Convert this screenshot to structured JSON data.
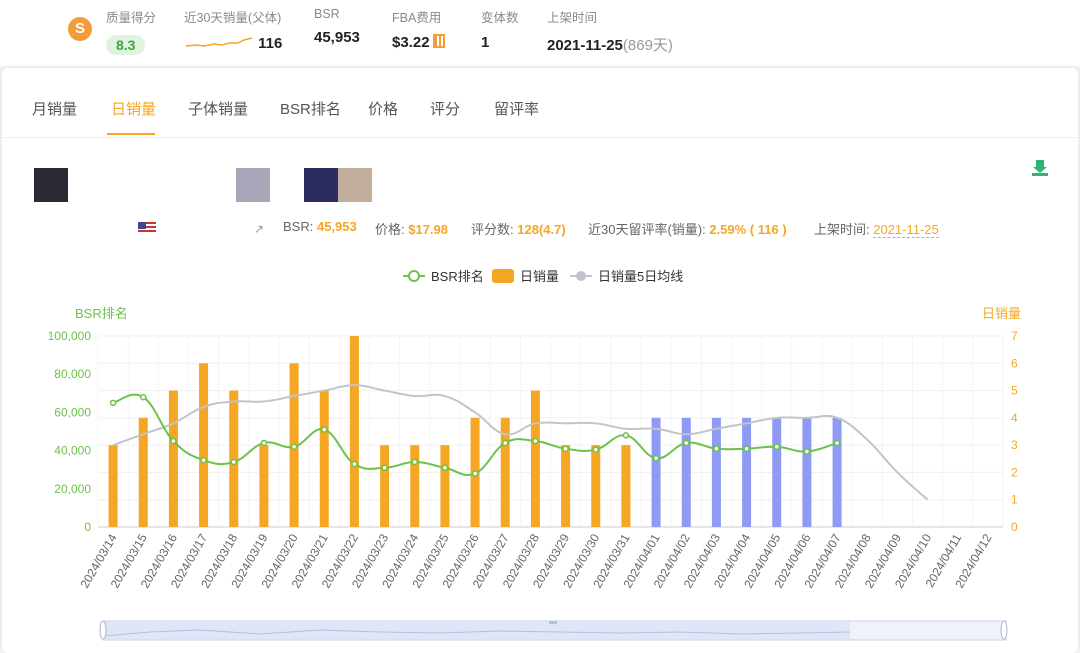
{
  "header": {
    "metrics": [
      {
        "label": "质量得分",
        "value": "8.3"
      },
      {
        "label": "近30天销量(父体)",
        "value": "116"
      },
      {
        "label": "BSR",
        "value": "45,953"
      },
      {
        "label": "FBA费用",
        "value": "$3.22"
      },
      {
        "label": "变体数",
        "value": "1"
      },
      {
        "label": "上架时间",
        "value": "2021-11-25",
        "extra": "(869天)"
      }
    ]
  },
  "tabs": [
    "月销量",
    "日销量",
    "子体销量",
    "BSR排名",
    "价格",
    "评分",
    "留评率"
  ],
  "active_tab": "日销量",
  "swatch_colors": [
    "#2a2a35",
    "#a8a6b8",
    "#2a2d5e",
    "#c2ae9c"
  ],
  "info": {
    "bsr_label": "BSR: ",
    "bsr_value": "45,953",
    "price_label": "价格: ",
    "price_value": "$17.98",
    "reviews_label": "评分数: ",
    "reviews_value": "128(4.7)",
    "rate_label": "近30天留评率(销量): ",
    "rate_value": "2.59% ( 116 )",
    "listed_label": "上架时间: ",
    "listed_value": "2021-11-25"
  },
  "colors": {
    "accent": "#f5a623",
    "bsr_line": "#6cc24a",
    "avg_line": "#c0c4cc",
    "forecast_bar": "#8f9af5"
  },
  "chart_data": {
    "type": "bar",
    "legend_position": "top-center",
    "y_left_label": "BSR排名",
    "y_right_label": "日销量",
    "y_left_ticks": [
      "0",
      "20,000",
      "40,000",
      "60,000",
      "80,000",
      "100,000"
    ],
    "y_right_ticks": [
      "0",
      "1",
      "2",
      "3",
      "4",
      "5",
      "6",
      "7"
    ],
    "ylim_left": [
      0,
      100000
    ],
    "ylim_right": [
      0,
      7
    ],
    "categories": [
      "2024/03/14",
      "2024/03/15",
      "2024/03/16",
      "2024/03/17",
      "2024/03/18",
      "2024/03/19",
      "2024/03/20",
      "2024/03/21",
      "2024/03/22",
      "2024/03/23",
      "2024/03/24",
      "2024/03/25",
      "2024/03/26",
      "2024/03/27",
      "2024/03/28",
      "2024/03/29",
      "2024/03/30",
      "2024/03/31",
      "2024/04/01",
      "2024/04/02",
      "2024/04/03",
      "2024/04/04",
      "2024/04/05",
      "2024/04/06",
      "2024/04/07",
      "2024/04/08",
      "2024/04/09",
      "2024/04/10",
      "2024/04/11",
      "2024/04/12"
    ],
    "series": [
      {
        "name": "BSR排名",
        "type": "line",
        "axis": "left",
        "values": [
          65000,
          68000,
          45000,
          35000,
          34000,
          44000,
          42000,
          51000,
          33000,
          31000,
          34000,
          31000,
          28000,
          44000,
          45000,
          41000,
          40500,
          48000,
          36000,
          44000,
          41000,
          41000,
          42000,
          39500,
          44000,
          null,
          null,
          null,
          null,
          null
        ]
      },
      {
        "name": "日销量",
        "type": "bar",
        "axis": "right",
        "values": [
          3,
          4,
          5,
          6,
          5,
          3,
          6,
          5,
          7,
          3,
          3,
          3,
          4,
          4,
          5,
          3,
          3,
          3,
          4,
          4,
          4,
          4,
          4,
          4,
          4,
          null,
          null,
          null,
          null,
          null
        ],
        "forecast_from_index": 18
      },
      {
        "name": "日销量5日均线",
        "type": "line",
        "axis": "right",
        "values": [
          3.0,
          3.4,
          3.8,
          4.4,
          4.6,
          4.6,
          4.8,
          5.0,
          5.2,
          5.0,
          4.8,
          4.8,
          4.2,
          3.4,
          3.8,
          3.8,
          3.8,
          3.6,
          3.6,
          3.4,
          3.6,
          3.8,
          4.0,
          4.0,
          4.0,
          3.2,
          2.0,
          1.0,
          null,
          null
        ]
      }
    ]
  }
}
